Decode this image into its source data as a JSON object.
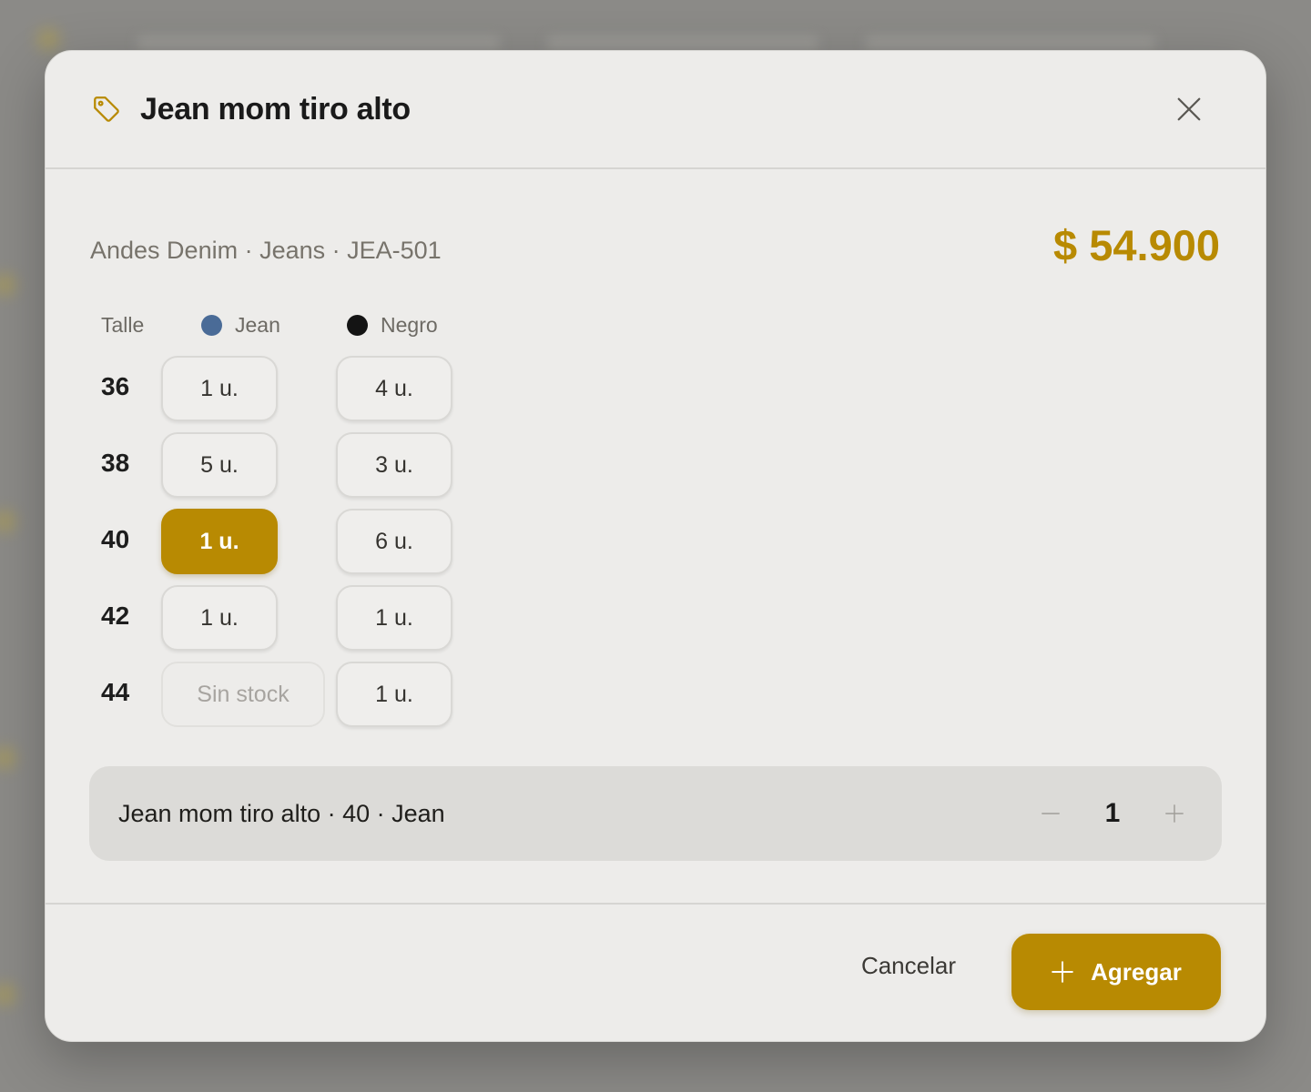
{
  "product": {
    "title": "Jean mom tiro alto",
    "subtitle": "Andes Denim · Jeans · JEA-501",
    "price": "$ 54.900"
  },
  "grid": {
    "size_header": "Talle",
    "colors": [
      {
        "name": "Jean",
        "swatch": "#4a6b97"
      },
      {
        "name": "Negro",
        "swatch": "#141414"
      }
    ],
    "rows": [
      {
        "size": "36",
        "cells": [
          "1 u.",
          "4 u."
        ]
      },
      {
        "size": "38",
        "cells": [
          "5 u.",
          "3 u."
        ]
      },
      {
        "size": "40",
        "cells": [
          "1 u.",
          "6 u."
        ]
      },
      {
        "size": "42",
        "cells": [
          "1 u.",
          "1 u."
        ]
      },
      {
        "size": "44",
        "cells": [
          "Sin stock",
          "1 u."
        ]
      }
    ],
    "selected": {
      "size": "40",
      "color": "Jean"
    }
  },
  "summary": {
    "text": "Jean mom tiro alto · 40 · Jean",
    "quantity": "1"
  },
  "footer": {
    "cancel_label": "Cancelar",
    "add_label": "Agregar"
  },
  "colors": {
    "accent": "#b88a02"
  }
}
